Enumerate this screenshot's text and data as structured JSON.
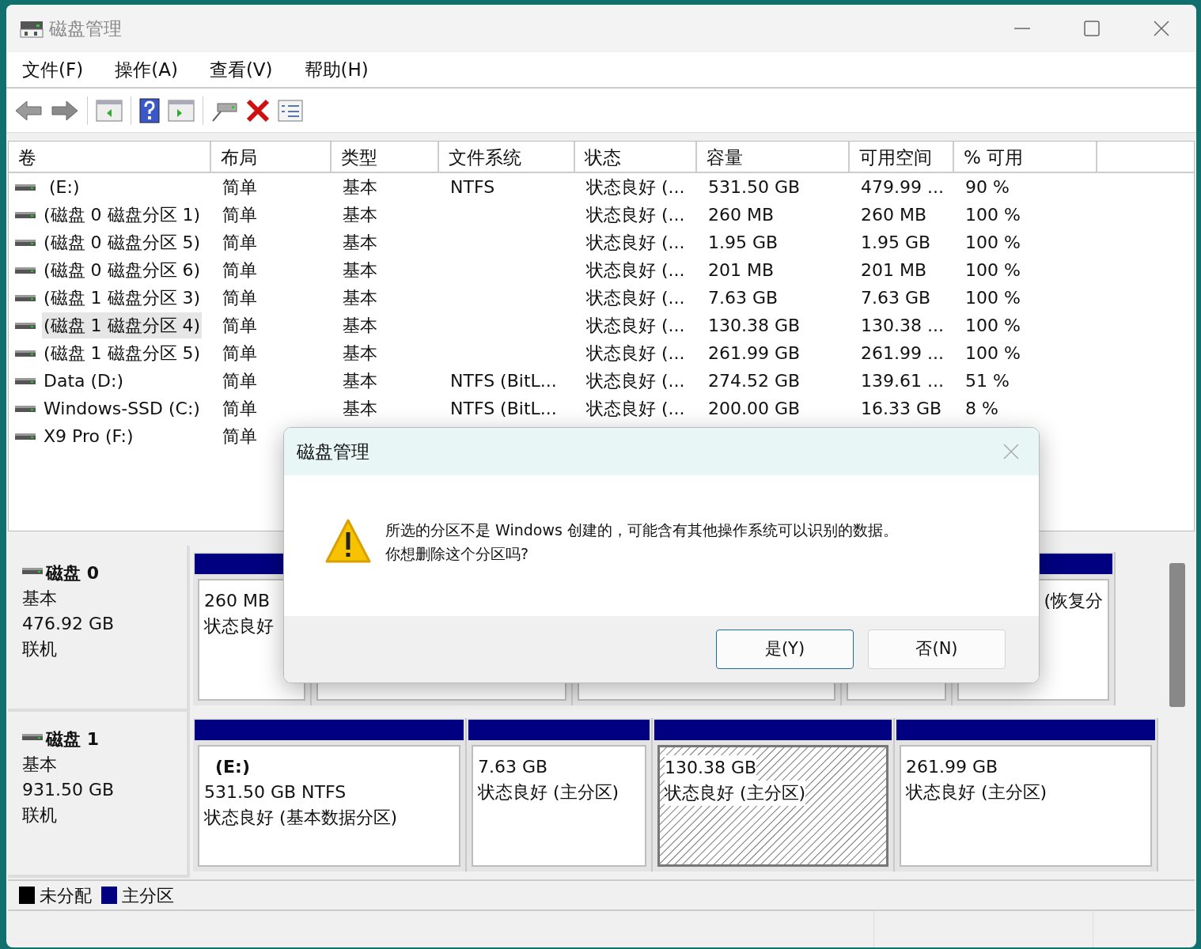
{
  "window": {
    "title": "磁盘管理"
  },
  "menu": [
    "文件(F)",
    "操作(A)",
    "查看(V)",
    "帮助(H)"
  ],
  "volumes": {
    "columns": [
      "卷",
      "布局",
      "类型",
      "文件系统",
      "状态",
      "容量",
      "可用空间",
      "% 可用"
    ],
    "rows": [
      {
        "cells": [
          " (E:)",
          "简单",
          "基本",
          "NTFS",
          "状态良好 (...",
          "531.50 GB",
          "479.99 ...",
          "90 %"
        ],
        "selected": false
      },
      {
        "cells": [
          "(磁盘 0 磁盘分区 1)",
          "简单",
          "基本",
          "",
          "状态良好 (...",
          "260 MB",
          "260 MB",
          "100 %"
        ],
        "selected": false
      },
      {
        "cells": [
          "(磁盘 0 磁盘分区 5)",
          "简单",
          "基本",
          "",
          "状态良好 (...",
          "1.95 GB",
          "1.95 GB",
          "100 %"
        ],
        "selected": false
      },
      {
        "cells": [
          "(磁盘 0 磁盘分区 6)",
          "简单",
          "基本",
          "",
          "状态良好 (...",
          "201 MB",
          "201 MB",
          "100 %"
        ],
        "selected": false
      },
      {
        "cells": [
          "(磁盘 1 磁盘分区 3)",
          "简单",
          "基本",
          "",
          "状态良好 (...",
          "7.63 GB",
          "7.63 GB",
          "100 %"
        ],
        "selected": false
      },
      {
        "cells": [
          "(磁盘 1 磁盘分区 4)",
          "简单",
          "基本",
          "",
          "状态良好 (...",
          "130.38 GB",
          "130.38 ...",
          "100 %"
        ],
        "selected": true
      },
      {
        "cells": [
          "(磁盘 1 磁盘分区 5)",
          "简单",
          "基本",
          "",
          "状态良好 (...",
          "261.99 GB",
          "261.99 ...",
          "100 %"
        ],
        "selected": false
      },
      {
        "cells": [
          "Data (D:)",
          "简单",
          "基本",
          "NTFS (BitL...",
          "状态良好 (...",
          "274.52 GB",
          "139.61 ...",
          "51 %"
        ],
        "selected": false
      },
      {
        "cells": [
          "Windows-SSD (C:)",
          "简单",
          "基本",
          "NTFS (BitL...",
          "状态良好 (...",
          "200.00 GB",
          "16.33 GB",
          "8 %"
        ],
        "selected": false
      },
      {
        "cells": [
          "X9 Pro (F:)",
          "简单"
        ],
        "selected": false
      }
    ]
  },
  "disks": [
    {
      "name": "磁盘 0",
      "type": "基本",
      "size": "476.92 GB",
      "status": "联机",
      "partitions": [
        {
          "lines": [
            "260 MB",
            "状态良好"
          ],
          "selected": false
        },
        {
          "selected": false
        },
        {
          "selected": false
        },
        {
          "selected": false
        },
        {
          "lines": [
            "(恢复分"
          ],
          "selected": false
        }
      ]
    },
    {
      "name": "磁盘 1",
      "type": "基本",
      "size": "931.50 GB",
      "status": "联机",
      "partitions": [
        {
          "label": "(E:)",
          "lines": [
            "531.50 GB NTFS",
            "状态良好 (基本数据分区)"
          ],
          "selected": false
        },
        {
          "lines": [
            "7.63 GB",
            "状态良好 (主分区)"
          ],
          "selected": false
        },
        {
          "lines": [
            "130.38 GB",
            "状态良好 (主分区)"
          ],
          "selected": true
        },
        {
          "lines": [
            "261.99 GB",
            "状态良好 (主分区)"
          ],
          "selected": false
        }
      ]
    }
  ],
  "legend": [
    {
      "label": "未分配",
      "color": "#000000"
    },
    {
      "label": "主分区",
      "color": "#000080"
    }
  ],
  "dialog": {
    "title": "磁盘管理",
    "message": [
      "所选的分区不是 Windows 创建的，可能含有其他操作系统可以识别的数据。",
      "你想删除这个分区吗?"
    ],
    "buttons": [
      {
        "label": "是(Y)",
        "default": true
      },
      {
        "label": "否(N)",
        "default": false
      }
    ]
  }
}
